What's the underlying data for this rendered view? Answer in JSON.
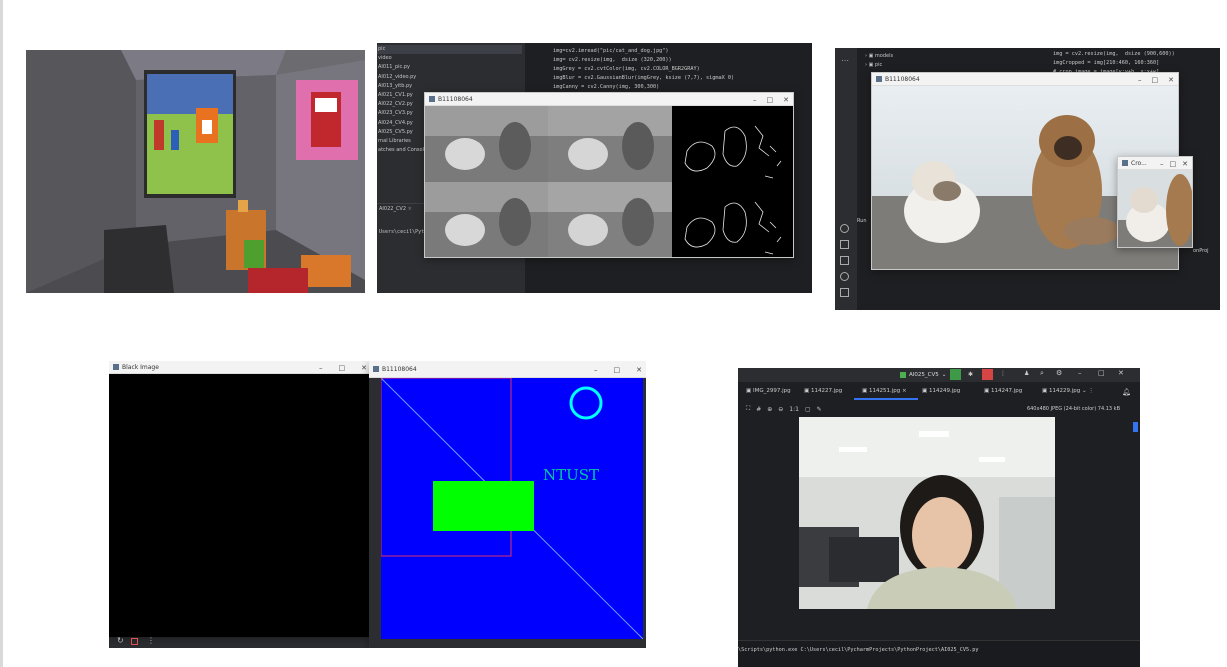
{
  "colors": {
    "ide_bg": "#1e1f22",
    "black_image_bg": "#000000",
    "blue_canvas": "#0000ff",
    "green_rect": "#00ff00",
    "cyan_circle": "#00ffff",
    "ntust_text": "#00c8a0"
  },
  "panel_game": {
    "description_icon": "voxel-game-scene"
  },
  "panel_code1": {
    "tree_items": [
      "pic",
      "video",
      "AI011_pic.py",
      "AI012_video.py",
      "AI013_yitb.py",
      "AI021_CV1.py",
      "AI022_CV2.py",
      "AI023_CV3.py",
      "AI024_CV4.py",
      "AI025_CV5.py",
      "rnal Libraries",
      "atches and Consoles"
    ],
    "code_lines": [
      "img=cv2.imread(\"pic/cat_and_dog.jpg\")",
      "img= cv2.resize(img,  dsize (320,200))",
      "imgGrey = cv2.cvtColor(img, cv2.COLOR_BGR2GRAY)",
      "imgBlur = cv2.GaussianBlur(imgGrey, ksize (7,7), sigmaX 0)",
      "imgCanny = cv2.Canny(img, 300,300)"
    ],
    "window_title": "B11108064",
    "run_tab": "AI022_CV2",
    "terminal_text": "Users\\cecil\\Pyt"
  },
  "panel_code2": {
    "tree_items": [
      "models",
      "pic"
    ],
    "code_lines": [
      "img = cv2.resize(img,  dsize (900,600))",
      "imgCropped = img[210:460, 160:360]",
      "# crop image = image[y:y+h, x:x+w]"
    ],
    "main_window_title": "B11108064",
    "small_window_title": "Cro...",
    "run_label": "Run",
    "side_text": "onProj"
  },
  "panel_draw": {
    "black_window_title": "Black Image",
    "blue_window_title": "B11108064",
    "ntust_label": "NTUST"
  },
  "panel_viewer": {
    "project_badge": "AI025_CV5",
    "tabs": [
      "IMG_2997.jpg",
      "114227.jpg",
      "114251.jpg",
      "114249.jpg",
      "114247.jpg",
      "114229.jpg"
    ],
    "active_tab_index": 2,
    "zoom_label": "1:1",
    "image_info": "640x480 JPEG (24-bit color) 74.13 kB",
    "terminal_text": "\\Scripts\\python.exe C:\\Users\\cecil\\PycharmProjects\\PythonProject\\AI025_CV5.py"
  }
}
